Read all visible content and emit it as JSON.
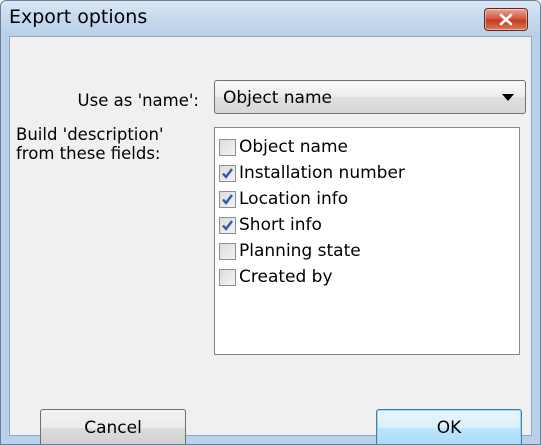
{
  "window": {
    "title": "Export options"
  },
  "form": {
    "name_label": "Use as 'name':",
    "name_select_value": "Object name",
    "description_label_line1": "Build 'description'",
    "description_label_line2": "from these fields:"
  },
  "fields": [
    {
      "label": "Object name",
      "checked": false
    },
    {
      "label": "Installation number",
      "checked": true
    },
    {
      "label": "Location info",
      "checked": true
    },
    {
      "label": "Short info",
      "checked": true
    },
    {
      "label": "Planning state",
      "checked": false
    },
    {
      "label": "Created by",
      "checked": false
    }
  ],
  "buttons": {
    "cancel_label": "Cancel",
    "ok_label": "OK"
  },
  "colors": {
    "titlebar": "#c7d9ee",
    "close_button": "#c3391f",
    "check_mark": "#2a5db0",
    "client_bg": "#f0f0f0"
  },
  "icons": {
    "close": "close-icon",
    "dropdown": "chevron-down-icon",
    "check": "checkmark-icon"
  }
}
